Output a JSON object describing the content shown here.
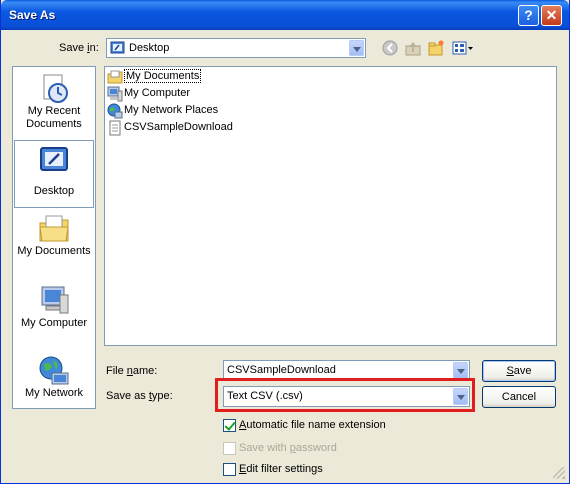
{
  "window": {
    "title": "Save As",
    "help_glyph": "?",
    "close_glyph": "✕"
  },
  "save_in": {
    "label_pre": "Save ",
    "label_u": "i",
    "label_post": "n:",
    "value": "Desktop"
  },
  "toolbar": {
    "icons": [
      "back-icon",
      "up-folder-icon",
      "new-folder-icon",
      "views-menu-icon"
    ]
  },
  "places": [
    {
      "label_line1": "My Recent",
      "label_line2": "Documents",
      "icon": "recent-documents-icon"
    },
    {
      "label_line1": "Desktop",
      "label_line2": "",
      "icon": "desktop-icon",
      "selected": true
    },
    {
      "label_line1": "My Documents",
      "label_line2": "",
      "icon": "my-documents-icon"
    },
    {
      "label_line1": "My Computer",
      "label_line2": "",
      "icon": "my-computer-icon"
    },
    {
      "label_line1": "My Network",
      "label_line2": "",
      "icon": "my-network-icon"
    }
  ],
  "files": [
    {
      "name": "My Documents",
      "icon": "my-documents-icon"
    },
    {
      "name": "My Computer",
      "icon": "my-computer-icon"
    },
    {
      "name": "My Network Places",
      "icon": "my-network-icon"
    },
    {
      "name": "CSVSampleDownload",
      "icon": "csv-file-icon"
    }
  ],
  "file_name": {
    "label_pre": "File ",
    "label_u": "n",
    "label_post": "ame:",
    "value": "CSVSampleDownload"
  },
  "save_as_type": {
    "label_pre": "Save as ",
    "label_u": "t",
    "label_post": "ype:",
    "value": "Text CSV (.csv)"
  },
  "buttons": {
    "save_u": "S",
    "save_rest": "ave",
    "cancel": "Cancel"
  },
  "options": {
    "auto_ext_u": "A",
    "auto_ext_rest": "utomatic file name extension",
    "auto_ext_checked": true,
    "password_pre": "Save with ",
    "password_u": "p",
    "password_post": "assword",
    "password_disabled": true,
    "filter_pre": "",
    "filter_u": "E",
    "filter_post": "dit filter settings",
    "filter_checked": false
  },
  "colors": {
    "title_bar": "#0a57e0",
    "highlight": "#e01e1e",
    "dialog_bg": "#ece9d8"
  }
}
